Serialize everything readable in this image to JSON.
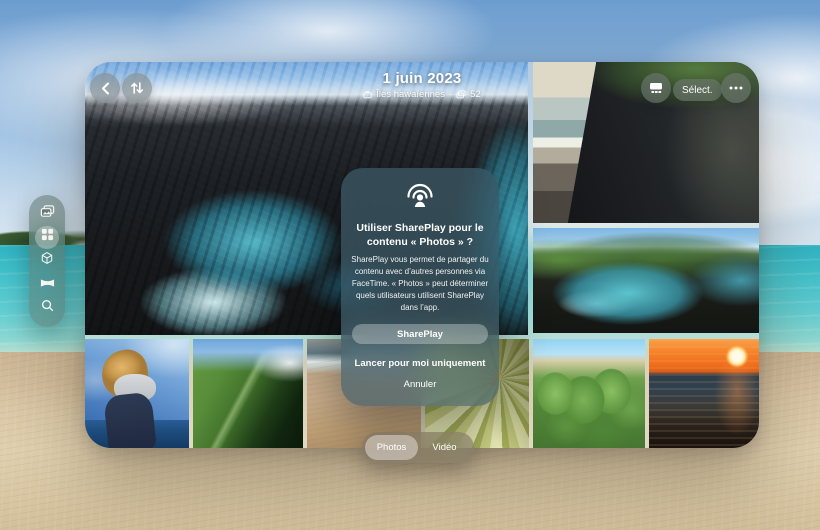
{
  "header": {
    "date": "1 juin 2023",
    "location": "Îles hawaïennes",
    "separator": "·",
    "photo_count": "52"
  },
  "toolbar": {
    "select": "Sélect.",
    "icons": [
      "back-icon",
      "reorder-icon",
      "grid-view-icon",
      "more-icon"
    ]
  },
  "sidebar": {
    "selected_index": 1,
    "items": [
      {
        "icon": "photos-stack-icon"
      },
      {
        "icon": "albums-grid-icon"
      },
      {
        "icon": "spatial-cube-icon"
      },
      {
        "icon": "panorama-icon"
      },
      {
        "icon": "search-icon"
      }
    ]
  },
  "dialog": {
    "icon": "shareplay-icon",
    "title": "Utiliser SharePlay pour le contenu « Photos » ?",
    "body": "SharePlay vous permet de partager du contenu avec d’autres personnes via FaceTime. « Photos » peut déterminer quels utilisateurs utilisent SharePlay dans l’app.",
    "primary": "SharePlay",
    "secondary": "Lancer pour moi uniquement",
    "cancel": "Annuler"
  },
  "tabs": {
    "photos": "Photos",
    "video": "Vidéo"
  },
  "photos": [
    {
      "name": "lava-coast-hero"
    },
    {
      "name": "dark-rock-cave-beach"
    },
    {
      "name": "black-rock-cove"
    },
    {
      "name": "woman-on-cliff"
    },
    {
      "name": "green-cliffs"
    },
    {
      "name": "beach-waves"
    },
    {
      "name": "yellow-flower"
    },
    {
      "name": "cactus-plants"
    },
    {
      "name": "ocean-sunset"
    }
  ],
  "colors": {
    "sea": "#46c2cb",
    "sand": "#d8c5a4",
    "sky": "#85aed8",
    "glass_tint": "#687e78",
    "dialog_tint": "#3e5c68"
  }
}
